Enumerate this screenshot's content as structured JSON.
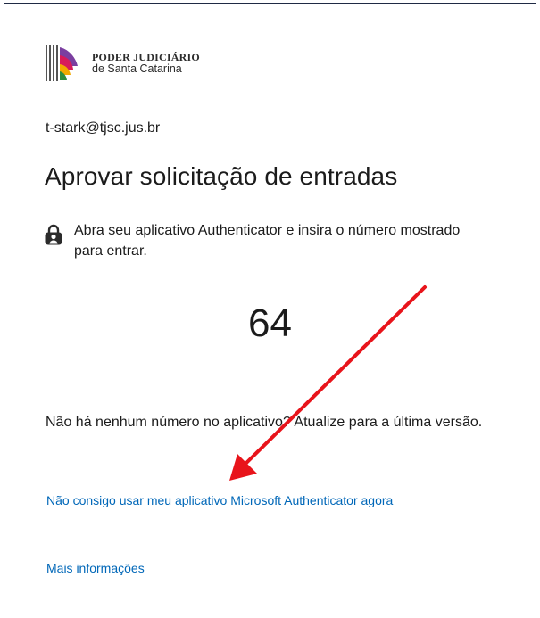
{
  "logo": {
    "line1": "PODER JUDICIÁRIO",
    "line2": "de Santa Catarina"
  },
  "identity": "t-stark@tjsc.jus.br",
  "title": "Aprovar solicitação de entradas",
  "instruction": "Abra seu aplicativo Authenticator e insira o número mostrado para entrar.",
  "code": "64",
  "hint": "Não há nenhum número no aplicativo? Atualize para a última versão.",
  "links": {
    "cant_use": "Não consigo usar meu aplicativo Microsoft Authenticator agora",
    "more_info": "Mais informações"
  },
  "colors": {
    "link": "#0067b8",
    "annotation_arrow": "#e8141b",
    "frame_border": "#1f2a44"
  },
  "icons": {
    "lock": "lock-icon",
    "logo": "tjsc-logo-icon",
    "annotation": "red-arrow-annotation"
  }
}
